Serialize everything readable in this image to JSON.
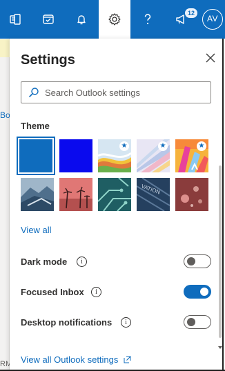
{
  "topbar": {
    "notification_count": "12",
    "avatar_initials": "AV",
    "colors": {
      "bar": "#0f6cbd",
      "active": "#ffffff"
    }
  },
  "background_page": {
    "peek_text": "Bo",
    "peek_text_bottom": "RM"
  },
  "settings": {
    "title": "Settings",
    "search": {
      "placeholder": "Search Outlook settings",
      "value": ""
    },
    "theme_section": {
      "label": "Theme",
      "selected_index": 0,
      "themes": [
        {
          "name": "blue",
          "premium": false
        },
        {
          "name": "dark-blue",
          "premium": false
        },
        {
          "name": "rainbow-wave",
          "premium": true
        },
        {
          "name": "prism",
          "premium": true
        },
        {
          "name": "crayon",
          "premium": true
        },
        {
          "name": "mountain",
          "premium": false
        },
        {
          "name": "palm-sunset",
          "premium": false
        },
        {
          "name": "circuit",
          "premium": false
        },
        {
          "name": "innovation",
          "premium": false
        },
        {
          "name": "bokeh",
          "premium": false
        }
      ],
      "view_all_label": "View all"
    },
    "toggles": [
      {
        "label": "Dark mode",
        "on": false
      },
      {
        "label": "Focused Inbox",
        "on": true
      },
      {
        "label": "Desktop notifications",
        "on": false
      }
    ],
    "footer_link": "View all Outlook settings"
  }
}
